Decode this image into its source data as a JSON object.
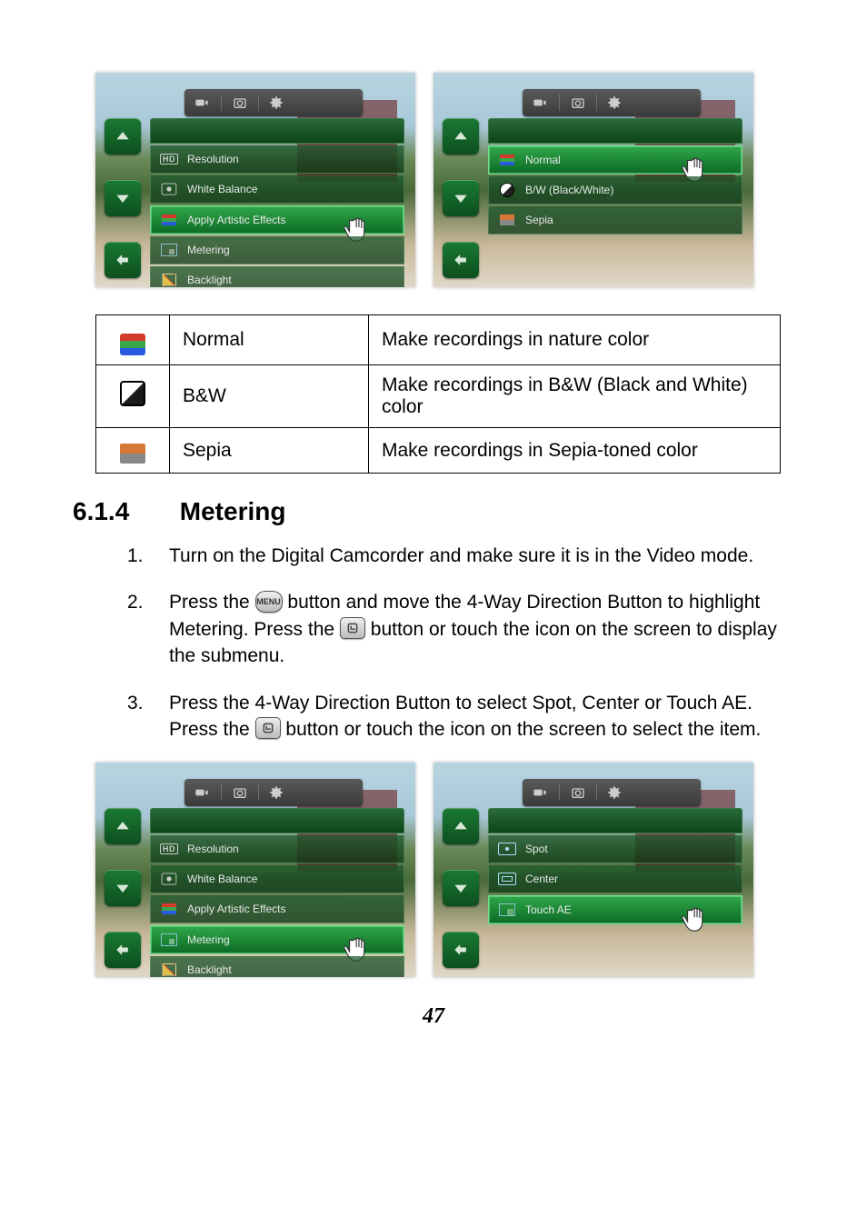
{
  "screenshots": {
    "top_left": {
      "menu": [
        {
          "icon": "hd",
          "label": "Resolution"
        },
        {
          "icon": "wb",
          "label": "White Balance"
        },
        {
          "icon": "effects",
          "label": "Apply Artistic Effects",
          "highlight": true,
          "pointer": true
        },
        {
          "icon": "metering",
          "label": "Metering"
        },
        {
          "icon": "backlight",
          "label": "Backlight"
        }
      ]
    },
    "top_right": {
      "menu": [
        {
          "icon": "normal",
          "label": "Normal",
          "highlight": true,
          "pointer": true
        },
        {
          "icon": "bw",
          "label": "B/W (Black/White)"
        },
        {
          "icon": "sepia",
          "label": "Sepia"
        }
      ]
    },
    "bottom_left": {
      "menu": [
        {
          "icon": "hd",
          "label": "Resolution"
        },
        {
          "icon": "wb",
          "label": "White Balance"
        },
        {
          "icon": "effects",
          "label": "Apply Artistic Effects"
        },
        {
          "icon": "metering",
          "label": "Metering",
          "highlight": true,
          "pointer": true
        },
        {
          "icon": "backlight",
          "label": "Backlight"
        }
      ]
    },
    "bottom_right": {
      "menu": [
        {
          "icon": "spot",
          "label": "Spot"
        },
        {
          "icon": "center",
          "label": "Center"
        },
        {
          "icon": "touchae",
          "label": "Touch AE",
          "highlight": true,
          "pointer": true
        }
      ]
    }
  },
  "table": [
    {
      "icon": "normal",
      "name": "Normal",
      "desc": "Make recordings in nature color"
    },
    {
      "icon": "bw",
      "name": "B&W",
      "desc": "Make recordings in B&W (Black and White) color"
    },
    {
      "icon": "sepia",
      "name": "Sepia",
      "desc": "Make recordings in Sepia-toned color"
    }
  ],
  "heading": {
    "number": "6.1.4",
    "title": "Metering"
  },
  "steps": [
    {
      "n": "1.",
      "text": "Turn on the Digital Camcorder and make sure it is in the Video mode."
    },
    {
      "n": "2.",
      "pre": "Press the ",
      "mid1": " button and move the 4-Way Direction Button to highlight Metering. Press the ",
      "post": " button or touch the icon on the screen to display the submenu."
    },
    {
      "n": "3.",
      "pre": "Press the 4-Way Direction Button to select Spot, Center or Touch AE. Press the ",
      "post": " button or touch the icon on the screen to select the item."
    }
  ],
  "menu_button_label": "MENU",
  "page_number": "47"
}
